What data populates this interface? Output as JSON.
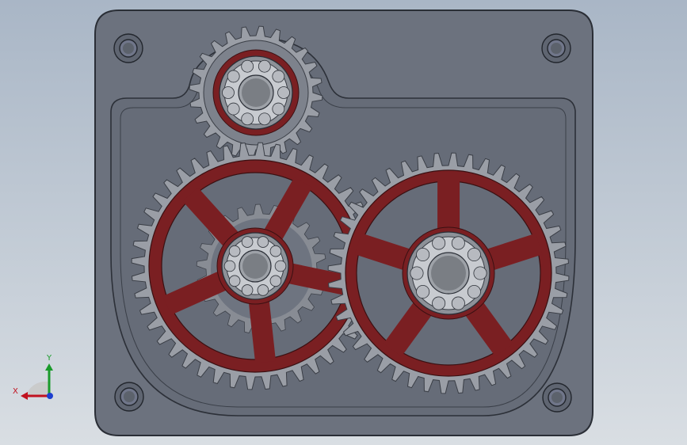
{
  "viewport": {
    "background_top": "#a9b6c6",
    "background_bottom": "#d9dee3"
  },
  "model": {
    "housing_color": "#6e7480",
    "housing_edge": "#2a2e36",
    "gear_tooth_color": "#9a9ea6",
    "gear_hub_red": "#7a1f22",
    "bearing_color": "#8d9198",
    "spur_gears": [
      {
        "name": "top-small-gear",
        "teeth": 24
      },
      {
        "name": "left-large-gear",
        "teeth": 44
      },
      {
        "name": "right-large-gear",
        "teeth": 44
      }
    ]
  },
  "triad": {
    "x_label": "X",
    "y_label": "Y",
    "x_color": "#c1121f",
    "y_color": "#1a9b2b",
    "z_color": "#1d3fcf"
  }
}
